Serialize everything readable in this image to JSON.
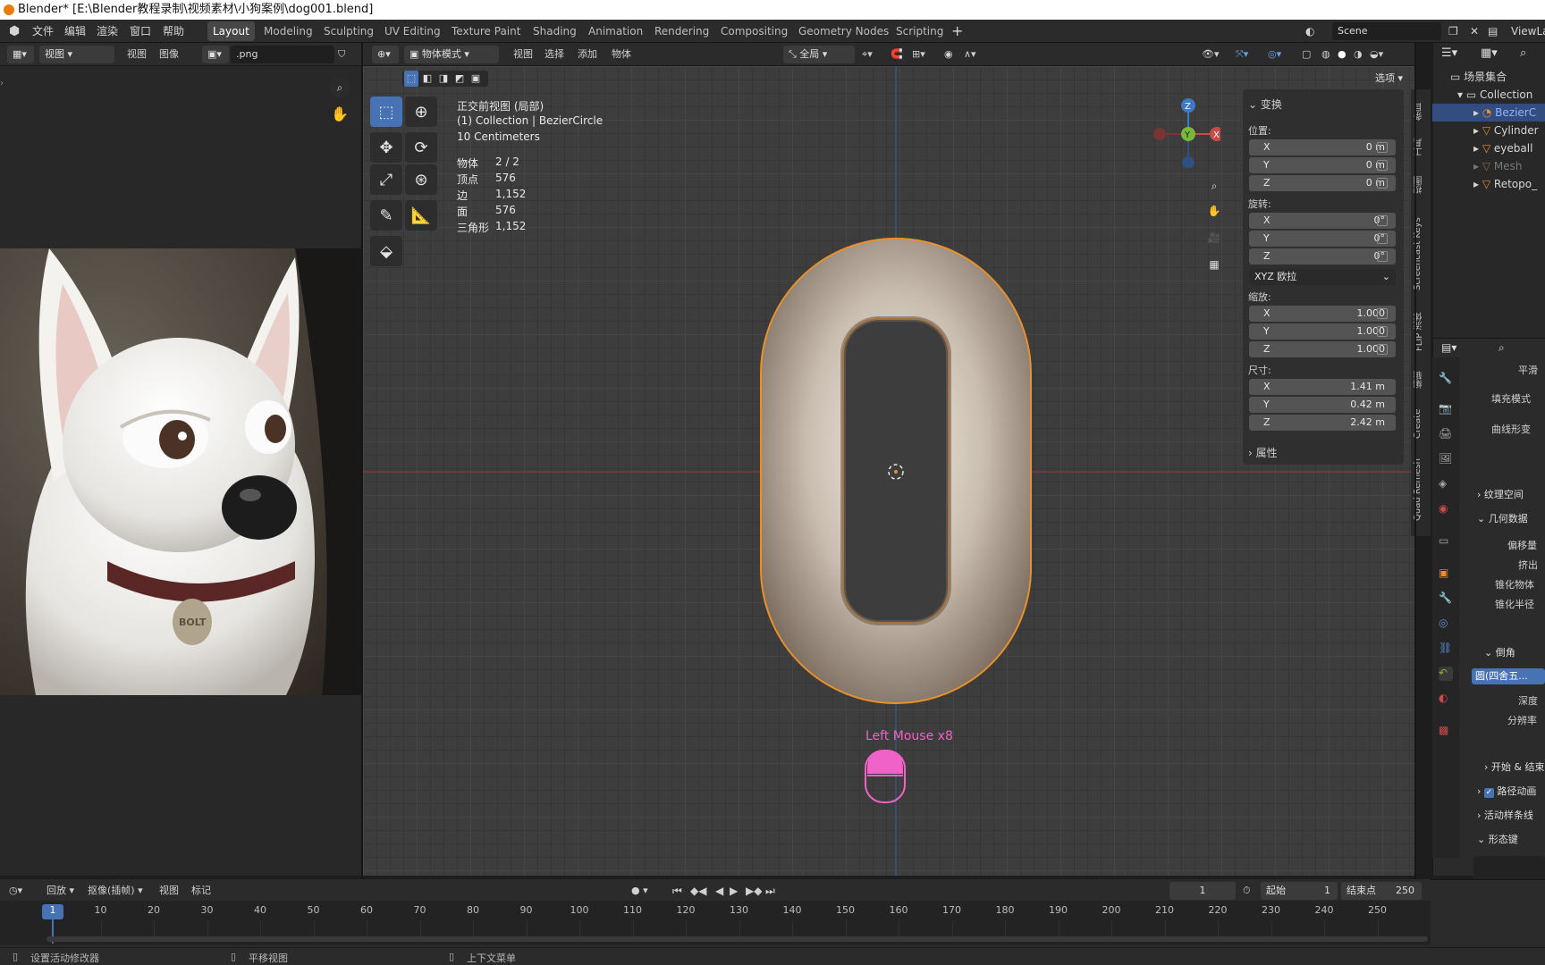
{
  "window": {
    "title": "Blender* [E:\\Blender教程录制\\视频素材\\小狗案例\\dog001.blend]"
  },
  "menu": {
    "items": [
      "文件",
      "编辑",
      "渲染",
      "窗口",
      "帮助"
    ],
    "workspaces": [
      "Layout",
      "Modeling",
      "Sculpting",
      "UV Editing",
      "Texture Paint",
      "Shading",
      "Animation",
      "Rendering",
      "Compositing",
      "Geometry Nodes",
      "Scripting"
    ],
    "active_workspace": "Layout",
    "scene": "Scene",
    "view_layer": "ViewLa"
  },
  "image_editor": {
    "view_dropdown": "视图",
    "menu_view": "视图",
    "menu_image": "图像",
    "image_name": ".png"
  },
  "viewport": {
    "mode": "物体模式",
    "menus": [
      "视图",
      "选择",
      "添加",
      "物体"
    ],
    "orientation": "全局",
    "options": "选项",
    "view_name": "正交前视图 (局部)",
    "collection_info": "(1) Collection | BezierCircle",
    "scale_info": "10 Centimeters",
    "stats": [
      {
        "label": "物体",
        "value": "2 / 2"
      },
      {
        "label": "顶点",
        "value": "576"
      },
      {
        "label": "边",
        "value": "1,152"
      },
      {
        "label": "面",
        "value": "576"
      },
      {
        "label": "三角形",
        "value": "1,152"
      }
    ],
    "gizmo": {
      "z": "Z",
      "y": "Y",
      "x": "X"
    },
    "keystroke": "Left Mouse x8"
  },
  "npanel": {
    "section_transform": "变换",
    "location_label": "位置:",
    "location": [
      {
        "axis": "X",
        "value": "0 m"
      },
      {
        "axis": "Y",
        "value": "0 m"
      },
      {
        "axis": "Z",
        "value": "0 m"
      }
    ],
    "rotation_label": "旋转:",
    "rotation": [
      {
        "axis": "X",
        "value": "0°"
      },
      {
        "axis": "Y",
        "value": "0°"
      },
      {
        "axis": "Z",
        "value": "0°"
      }
    ],
    "rotation_mode": "XYZ 欧拉",
    "scale_label": "缩放:",
    "scale": [
      {
        "axis": "X",
        "value": "1.000"
      },
      {
        "axis": "Y",
        "value": "1.000"
      },
      {
        "axis": "Z",
        "value": "1.000"
      }
    ],
    "dimensions_label": "尺寸:",
    "dimensions": [
      {
        "axis": "X",
        "value": "1.41 m"
      },
      {
        "axis": "Y",
        "value": "0.42 m"
      },
      {
        "axis": "Z",
        "value": "2.42 m"
      }
    ],
    "section_properties": "属性"
  },
  "side_tabs": [
    "条目",
    "工具",
    "视图",
    "Screencast Keys",
    "FLIP 流体",
    "编辑",
    "Create",
    "Quad Remesh"
  ],
  "outliner": {
    "root": "场景集合",
    "collection": "Collection",
    "items": [
      "BezierC",
      "Cylinder",
      "eyeball",
      "Mesh",
      "Retopo_"
    ]
  },
  "properties": {
    "smooth": "平滑",
    "fill_mode": "填充模式",
    "curve_deform": "曲线形变",
    "texture_space": "纹理空间",
    "geometry": "几何数据",
    "offset": "偏移量",
    "extrude": "挤出",
    "taper_object": "锥化物体",
    "taper_radius": "锥化半径",
    "bevel": "倒角",
    "bevel_mode": "圆(四舍五...",
    "depth": "深度",
    "resolution": "分辨率",
    "start_end": "开始 & 结束",
    "path_animation": "路径动画",
    "active_spline": "活动样条线",
    "shape_keys": "形态键"
  },
  "timeline": {
    "playback": "回放",
    "keying": "抠像(插帧)",
    "view": "视图",
    "marker": "标记",
    "current_frame": "1",
    "start_label": "起始",
    "start": "1",
    "end_label": "结束点",
    "end": "250",
    "ticks": [
      "1",
      "10",
      "20",
      "30",
      "40",
      "50",
      "60",
      "70",
      "80",
      "90",
      "100",
      "110",
      "120",
      "130",
      "140",
      "150",
      "160",
      "170",
      "180",
      "190",
      "200",
      "210",
      "220",
      "230",
      "240",
      "250"
    ]
  },
  "status": {
    "left": "设置活动修改器",
    "middle": "平移视图",
    "right": "上下文菜单"
  },
  "colors": {
    "accent": "#4772b3",
    "selection_outline": "#e8902b",
    "x_axis": "#c94a4a",
    "y_axis": "#7ab83a",
    "z_axis": "#3f78c8",
    "keystroke": "#f062c8"
  }
}
